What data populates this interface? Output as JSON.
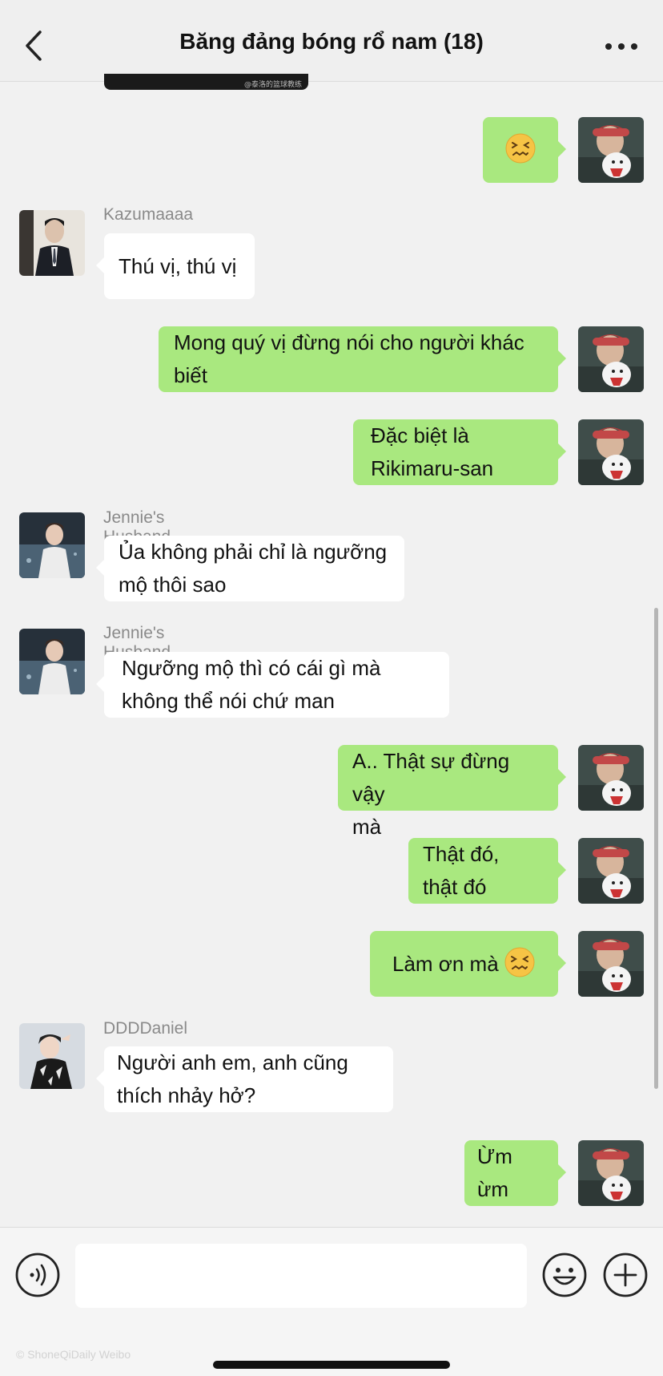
{
  "header": {
    "title": "Băng đảng bóng rổ nam (18)"
  },
  "clipped_image_caption": "@泰洛的篮球教练",
  "messages": [
    {
      "id": "m1",
      "direction": "out",
      "sender": "",
      "avatar": "self-avatar",
      "emoji": "confounded-face"
    },
    {
      "id": "m2",
      "direction": "in",
      "sender": "Kazumaaaa",
      "avatar": "kazumaaaa-avatar",
      "lines": [
        "Thú vị, thú vị"
      ]
    },
    {
      "id": "m3",
      "direction": "out",
      "avatar": "self-avatar",
      "lines": [
        "Mong quý vị đừng nói cho người khác",
        "biết"
      ]
    },
    {
      "id": "m4",
      "direction": "out",
      "avatar": "self-avatar",
      "lines": [
        "Đặc biệt là",
        "Rikimaru-san"
      ]
    },
    {
      "id": "m5",
      "direction": "in",
      "sender": "Jennie's Husband",
      "avatar": "jennies-husband-avatar",
      "lines": [
        "Ủa không phải chỉ là ngưỡng",
        "mộ thôi sao"
      ]
    },
    {
      "id": "m6",
      "direction": "in",
      "sender": "Jennie's Husband",
      "avatar": "jennies-husband-avatar",
      "lines": [
        "Ngưỡng mộ thì có cái gì mà",
        "không thể nói chứ man"
      ]
    },
    {
      "id": "m7",
      "direction": "out",
      "avatar": "self-avatar",
      "lines": [
        "A.. Thật sự đừng vậy",
        "mà"
      ]
    },
    {
      "id": "m8",
      "direction": "out",
      "avatar": "self-avatar",
      "lines": [
        "Thật đó,",
        "thật đó"
      ]
    },
    {
      "id": "m9",
      "direction": "out",
      "avatar": "self-avatar",
      "lines": [
        "Làm ơn mà "
      ],
      "emoji": "confounded-face"
    },
    {
      "id": "m10",
      "direction": "in",
      "sender": "DDDDaniel",
      "avatar": "dddddaniel-avatar",
      "lines": [
        "Người anh em, anh cũng",
        "thích nhảy hở?"
      ]
    },
    {
      "id": "m11",
      "direction": "out",
      "avatar": "self-avatar",
      "lines": [
        "Ừm ừm"
      ]
    }
  ],
  "input_bar": {
    "placeholder": "",
    "voice_icon": "voice-icon",
    "emoji_icon": "smiley-icon",
    "plus_icon": "plus-icon",
    "watermark": "© ShoneQiDaily Weibo"
  },
  "colors": {
    "outgoing_bubble": "#a9e87f",
    "incoming_bubble": "#ffffff",
    "background": "#f1f1f1"
  }
}
